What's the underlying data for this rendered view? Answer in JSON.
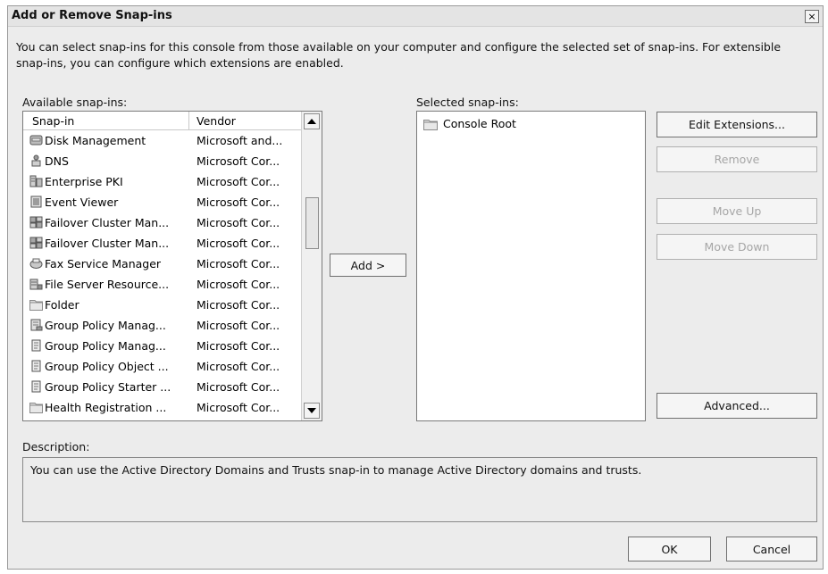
{
  "window": {
    "title": "Add or Remove Snap-ins",
    "close_glyph": "×"
  },
  "intro": "You can select snap-ins for this console from those available on your computer and configure the selected set of snap-ins. For extensible snap-ins, you can configure which extensions are enabled.",
  "available": {
    "label": "Available snap-ins:",
    "columns": [
      "Snap-in",
      "Vendor"
    ],
    "rows": [
      {
        "name": "Disk Management",
        "vendor": "Microsoft and...",
        "icon": "disk-icon"
      },
      {
        "name": "DNS",
        "vendor": "Microsoft Cor...",
        "icon": "dns-icon"
      },
      {
        "name": "Enterprise PKI",
        "vendor": "Microsoft Cor...",
        "icon": "pki-icon"
      },
      {
        "name": "Event Viewer",
        "vendor": "Microsoft Cor...",
        "icon": "event-viewer-icon"
      },
      {
        "name": "Failover Cluster Man...",
        "vendor": "Microsoft Cor...",
        "icon": "cluster-icon"
      },
      {
        "name": "Failover Cluster Man...",
        "vendor": "Microsoft Cor...",
        "icon": "cluster-icon"
      },
      {
        "name": "Fax Service Manager",
        "vendor": "Microsoft Cor...",
        "icon": "fax-icon"
      },
      {
        "name": "File Server Resource...",
        "vendor": "Microsoft Cor...",
        "icon": "file-server-icon"
      },
      {
        "name": "Folder",
        "vendor": "Microsoft Cor...",
        "icon": "folder-icon"
      },
      {
        "name": "Group Policy Manag...",
        "vendor": "Microsoft Cor...",
        "icon": "group-policy-mgmt-icon"
      },
      {
        "name": "Group Policy Manag...",
        "vendor": "Microsoft Cor...",
        "icon": "policy-document-icon"
      },
      {
        "name": "Group Policy Object ...",
        "vendor": "Microsoft Cor...",
        "icon": "policy-document-icon"
      },
      {
        "name": "Group Policy Starter ...",
        "vendor": "Microsoft Cor...",
        "icon": "policy-document-icon"
      },
      {
        "name": "Health Registration ...",
        "vendor": "Microsoft Cor...",
        "icon": "folder-icon"
      }
    ]
  },
  "add_button": "Add >",
  "selected": {
    "label": "Selected snap-ins:",
    "items": [
      {
        "name": "Console Root",
        "icon": "folder-icon"
      }
    ]
  },
  "buttons": {
    "edit_extensions": "Edit Extensions...",
    "remove": "Remove",
    "move_up": "Move Up",
    "move_down": "Move Down",
    "advanced": "Advanced...",
    "ok": "OK",
    "cancel": "Cancel"
  },
  "description": {
    "label": "Description:",
    "text": "You can use the Active Directory Domains and Trusts snap-in to manage Active Directory domains and trusts."
  },
  "colors": {
    "dialog_bg": "#ececec",
    "disabled_text": "#a6a6a6"
  }
}
